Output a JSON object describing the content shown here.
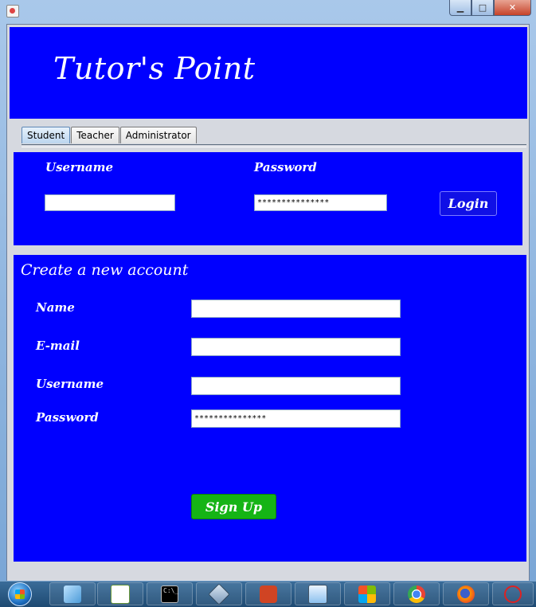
{
  "window": {
    "min_glyph": "▁",
    "max_glyph": "□",
    "close_glyph": "✕"
  },
  "header": {
    "title": "Tutor's Point"
  },
  "tabs": [
    {
      "label": "Student",
      "active": true
    },
    {
      "label": "Teacher",
      "active": false
    },
    {
      "label": "Administrator",
      "active": false
    }
  ],
  "login": {
    "username_label": "Username",
    "username_value": "",
    "password_label": "Password",
    "password_value": "***************",
    "login_button": "Login"
  },
  "signup": {
    "title": "Create a new account",
    "name_label": "Name",
    "name_value": "",
    "email_label": "E-mail",
    "email_value": "",
    "username_label": "Username",
    "username_value": "",
    "password_label": "Password",
    "password_value": "***************",
    "signup_button": "Sign Up"
  },
  "taskbar": {
    "items": [
      "start-orb",
      "notes-icon",
      "notepad-plus-icon",
      "command-prompt-icon",
      "virtualbox-icon",
      "powerpoint-icon",
      "control-panel-icon",
      "windows-flag-icon",
      "chrome-icon",
      "firefox-icon",
      "network-app-icon"
    ]
  },
  "colors": {
    "panel_blue": "#0000ff",
    "signup_green": "#15b415",
    "background": "#d6d9e0"
  }
}
